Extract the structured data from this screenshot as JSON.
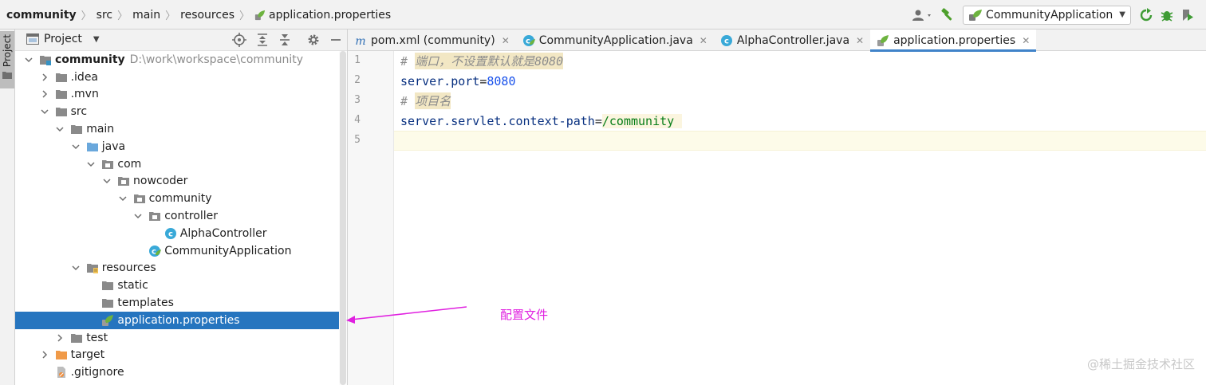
{
  "breadcrumb": {
    "items": [
      "community",
      "src",
      "main",
      "resources",
      "application.properties"
    ]
  },
  "run_toolbar": {
    "config_name": "CommunityApplication",
    "icons": [
      "user-icon",
      "build-hammer-icon",
      "rerun-icon",
      "debug-bug-icon",
      "run-with-coverage-icon"
    ]
  },
  "left_stripe": {
    "project_label": "Project"
  },
  "project_panel": {
    "title": "Project",
    "header_icons": [
      "locate-icon",
      "expand-all-icon",
      "collapse-all-icon",
      "settings-gear-icon",
      "hide-minus-icon"
    ],
    "tree": [
      {
        "label": "community",
        "hint": "D:\\work\\workspace\\community",
        "depth": 0,
        "arrow": "down",
        "icon": "module-folder",
        "bold": true
      },
      {
        "label": ".idea",
        "depth": 1,
        "arrow": "right",
        "icon": "folder"
      },
      {
        "label": ".mvn",
        "depth": 1,
        "arrow": "right",
        "icon": "folder"
      },
      {
        "label": "src",
        "depth": 1,
        "arrow": "down",
        "icon": "folder"
      },
      {
        "label": "main",
        "depth": 2,
        "arrow": "down",
        "icon": "folder"
      },
      {
        "label": "java",
        "depth": 3,
        "arrow": "down",
        "icon": "source-folder"
      },
      {
        "label": "com",
        "depth": 4,
        "arrow": "down",
        "icon": "package"
      },
      {
        "label": "nowcoder",
        "depth": 5,
        "arrow": "down",
        "icon": "package"
      },
      {
        "label": "community",
        "depth": 6,
        "arrow": "down",
        "icon": "package"
      },
      {
        "label": "controller",
        "depth": 7,
        "arrow": "down",
        "icon": "package"
      },
      {
        "label": "AlphaController",
        "depth": 8,
        "arrow": "none",
        "icon": "java-class"
      },
      {
        "label": "CommunityApplication",
        "depth": 7,
        "arrow": "none",
        "icon": "spring-class"
      },
      {
        "label": "resources",
        "depth": 3,
        "arrow": "down",
        "icon": "resources-folder"
      },
      {
        "label": "static",
        "depth": 4,
        "arrow": "none",
        "icon": "folder"
      },
      {
        "label": "templates",
        "depth": 4,
        "arrow": "none",
        "icon": "folder"
      },
      {
        "label": "application.properties",
        "depth": 4,
        "arrow": "none",
        "icon": "spring-properties",
        "selected": true
      },
      {
        "label": "test",
        "depth": 2,
        "arrow": "right",
        "icon": "folder"
      },
      {
        "label": "target",
        "depth": 1,
        "arrow": "right",
        "icon": "excluded-folder"
      },
      {
        "label": ".gitignore",
        "depth": 1,
        "arrow": "none",
        "icon": "ignore-file"
      }
    ]
  },
  "editor": {
    "tabs": [
      {
        "label": "pom.xml (community)",
        "icon": "maven-icon",
        "active": false
      },
      {
        "label": "CommunityApplication.java",
        "icon": "spring-class-icon",
        "active": false
      },
      {
        "label": "AlphaController.java",
        "icon": "java-class-icon",
        "active": false
      },
      {
        "label": "application.properties",
        "icon": "spring-properties-icon",
        "active": true
      }
    ],
    "line_numbers": [
      "1",
      "2",
      "3",
      "4",
      "5"
    ],
    "lines": {
      "l1_comment": "端口，不设置默认就是8080",
      "l2_key": "server.port",
      "l2_value": "8080",
      "l3_comment": "项目名",
      "l4_key": "server.servlet.context-path",
      "l4_value": "/community"
    }
  },
  "annotation": {
    "label": "配置文件",
    "color": "#e020e0"
  },
  "watermark": "@稀土掘金技术社区",
  "colors": {
    "selection": "#2675bf",
    "active_tab_underline": "#4083c9",
    "property_key": "#083080",
    "number": "#1750eb",
    "string_value": "#067d17",
    "comment": "#8c8c8c"
  }
}
